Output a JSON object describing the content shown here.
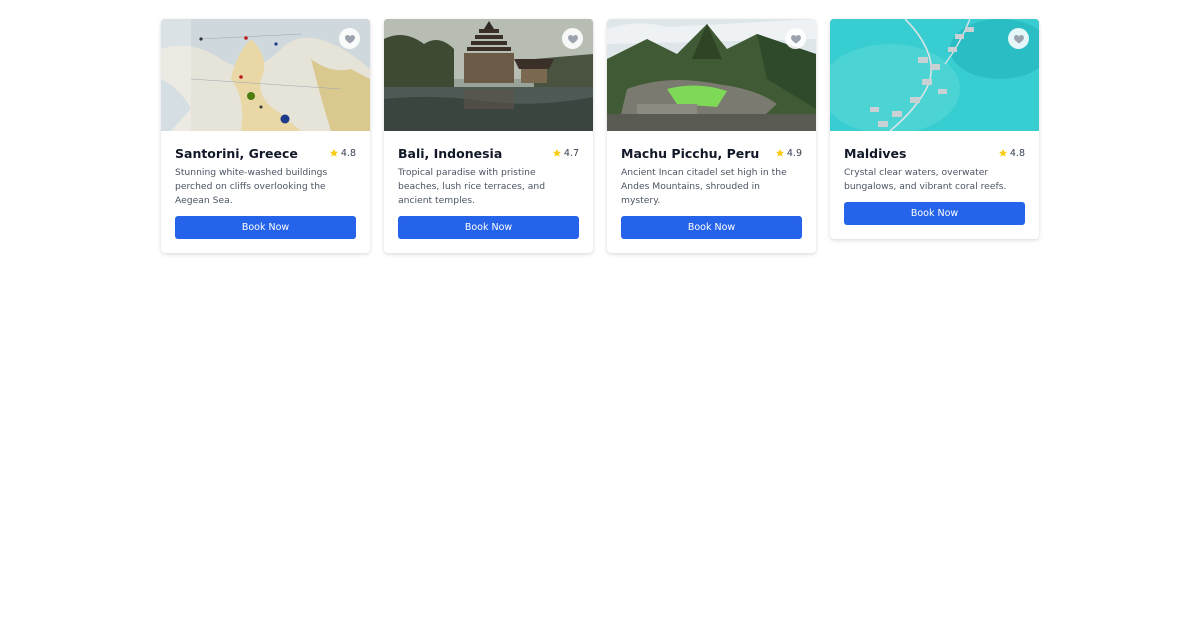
{
  "colors": {
    "accent": "#2563eb",
    "star": "#facc15",
    "heart": "#9ca3af"
  },
  "destinations": [
    {
      "title": "Santorini, Greece",
      "rating": "4.8",
      "description": "Stunning white-washed buildings perched on cliffs overlooking the Aegean Sea.",
      "button_label": "Book Now",
      "image": "map-with-pins"
    },
    {
      "title": "Bali, Indonesia",
      "rating": "4.7",
      "description": "Tropical paradise with pristine beaches, lush rice terraces, and ancient temples.",
      "button_label": "Book Now",
      "image": "temple-on-water"
    },
    {
      "title": "Machu Picchu, Peru",
      "rating": "4.9",
      "description": "Ancient Incan citadel set high in the Andes Mountains, shrouded in mystery.",
      "button_label": "Book Now",
      "image": "mountain-ruins"
    },
    {
      "title": "Maldives",
      "rating": "4.8",
      "description": "Crystal clear waters, overwater bungalows, and vibrant coral reefs.",
      "button_label": "Book Now",
      "image": "overwater-bungalows"
    }
  ],
  "icons": {
    "favorite": "heart-icon",
    "rating": "star-icon"
  }
}
